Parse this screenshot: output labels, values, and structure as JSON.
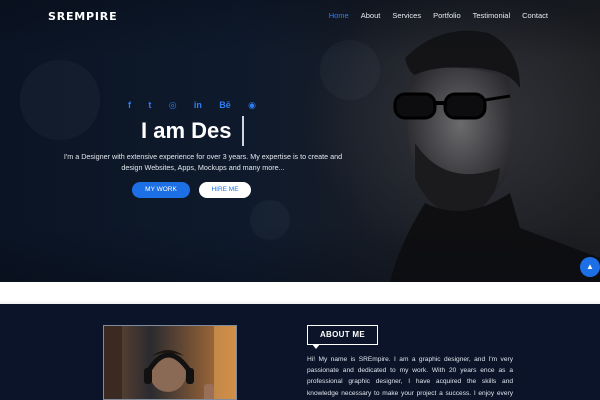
{
  "brand": "SREMPIRE",
  "nav": [
    "Home",
    "About",
    "Services",
    "Portfolio",
    "Testimonial",
    "Contact"
  ],
  "social_icons": [
    "facebook-icon",
    "twitter-icon",
    "instagram-icon",
    "linkedin-icon",
    "behance-icon",
    "dribbble-icon"
  ],
  "social_glyphs": [
    "f",
    "t",
    "◎",
    "in",
    "Bē",
    "◉"
  ],
  "hero": {
    "headline": "I am Des",
    "text": "I'm a Designer with extensive experience for over 3 years. My expertise is to create and design Websites, Apps, Mockups and many more...",
    "btn_work": "MY WORK",
    "btn_hire": "HIRE ME"
  },
  "about": {
    "title": "ABOUT ME",
    "text": "Hi! My name is SREmpire. I am a graphic designer, and I'm very passionate and dedicated to my work. With 20 years ence as a professional graphic designer, I have acquired the skills and knowledge necessary to make your project a success. I enjoy every step of the design process, from discussion and"
  },
  "colors": {
    "accent": "#1d6fe6",
    "dark": "#0b1428"
  }
}
